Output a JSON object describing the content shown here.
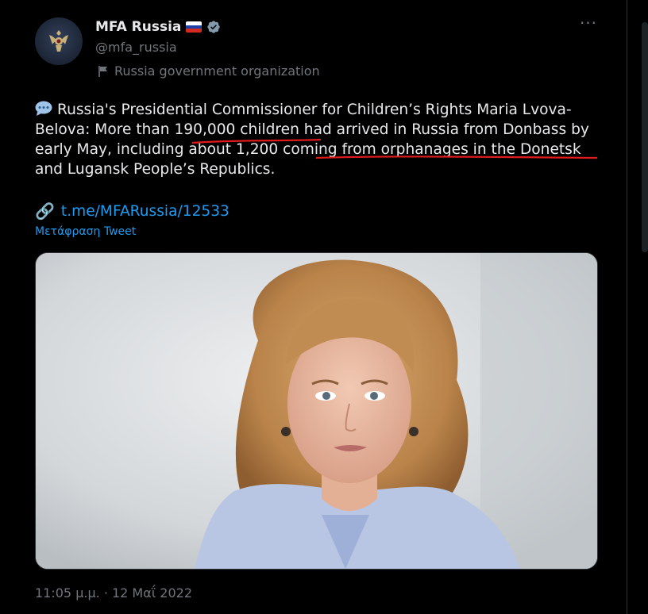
{
  "author": {
    "name": "MFA Russia",
    "handle": "@mfa_russia",
    "label": "Russia government organization",
    "flag_colors": [
      "#ffffff",
      "#1c3fa8",
      "#d52b1e"
    ],
    "verified_color": "#829aab"
  },
  "tweet": {
    "text_segments": [
      "Russia's Presidential Commissioner for Children’s Rights Maria Lvova-Belova: More than 190,000 children had arrived in Russia from Donbass by early May, including about 1,200 coming from orphanages in the Donetsk and Lugansk People’s Republics."
    ],
    "link": "t.me/MFARussia/12533",
    "translate_label": "Μετάφραση Tweet",
    "timestamp": "11:05 μ.μ. · 12 Μαΐ 2022"
  },
  "icons": {
    "more": "more-horizontal-icon",
    "speech": "speech-bubble-icon",
    "link": "link-icon",
    "org": "flag-icon"
  },
  "colors": {
    "link": "#1d9bf0",
    "annotation": "#e0191c"
  }
}
